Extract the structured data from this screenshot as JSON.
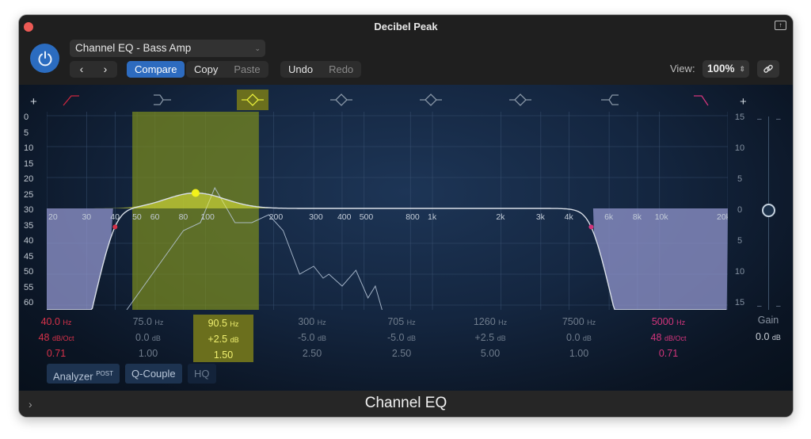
{
  "window": {
    "title": "Decibel Peak",
    "footer_title": "Channel EQ"
  },
  "toolbar": {
    "preset": "Channel EQ - Bass Amp",
    "prev_label": "‹",
    "next_label": "›",
    "compare_label": "Compare",
    "copy_label": "Copy",
    "paste_label": "Paste",
    "undo_label": "Undo",
    "redo_label": "Redo",
    "view_label": "View:",
    "view_value": "100%"
  },
  "graph": {
    "left_db_labels": [
      "0",
      "5",
      "10",
      "15",
      "20",
      "25",
      "30",
      "35",
      "40",
      "45",
      "50",
      "55",
      "60"
    ],
    "right_db_labels": [
      "15",
      "10",
      "5",
      "0",
      "5",
      "10",
      "15"
    ],
    "freq_labels": [
      "20",
      "30",
      "40",
      "50",
      "60",
      "80",
      "100",
      "200",
      "300",
      "400",
      "500",
      "800",
      "1k",
      "2k",
      "3k",
      "4k",
      "6k",
      "8k",
      "10k",
      "20k"
    ],
    "freq_values": [
      20,
      30,
      40,
      50,
      60,
      80,
      100,
      200,
      300,
      400,
      500,
      800,
      1000,
      2000,
      3000,
      4000,
      6000,
      8000,
      10000,
      20000
    ],
    "accent_color": "#e8ee3a",
    "active_band_index": 2
  },
  "bands": [
    {
      "name": "Low Cut",
      "type": "lowcut",
      "freq": "40.0",
      "freq_unit": "Hz",
      "gain": "48",
      "gain_unit": "dB/Oct",
      "q": "0.71",
      "color": "red",
      "enabled": true
    },
    {
      "name": "Low Shelf",
      "type": "lowshelf",
      "freq": "75.0",
      "freq_unit": "Hz",
      "gain": "0.0",
      "gain_unit": "dB",
      "q": "1.00",
      "color": "dim",
      "enabled": false
    },
    {
      "name": "Bell 1",
      "type": "bell",
      "freq": "90.5",
      "freq_unit": "Hz",
      "gain": "+2.5",
      "gain_unit": "dB",
      "q": "1.50",
      "color": "active",
      "enabled": true
    },
    {
      "name": "Bell 2",
      "type": "bell",
      "freq": "300",
      "freq_unit": "Hz",
      "gain": "-5.0",
      "gain_unit": "dB",
      "q": "2.50",
      "color": "dim",
      "enabled": false
    },
    {
      "name": "Bell 3",
      "type": "bell",
      "freq": "705",
      "freq_unit": "Hz",
      "gain": "-5.0",
      "gain_unit": "dB",
      "q": "2.50",
      "color": "dim",
      "enabled": false
    },
    {
      "name": "Bell 4",
      "type": "bell",
      "freq": "1260",
      "freq_unit": "Hz",
      "gain": "+2.5",
      "gain_unit": "dB",
      "q": "5.00",
      "color": "dim",
      "enabled": false
    },
    {
      "name": "High Shelf",
      "type": "highshelf",
      "freq": "7500",
      "freq_unit": "Hz",
      "gain": "0.0",
      "gain_unit": "dB",
      "q": "1.00",
      "color": "dim",
      "enabled": false
    },
    {
      "name": "High Cut",
      "type": "highcut",
      "freq": "5000",
      "freq_unit": "Hz",
      "gain": "48",
      "gain_unit": "dB/Oct",
      "q": "0.71",
      "color": "pink",
      "enabled": true
    }
  ],
  "master_gain": {
    "label": "Gain",
    "value": "0.0",
    "unit": "dB"
  },
  "options": {
    "analyzer_label": "Analyzer",
    "analyzer_mode": "POST",
    "qcouple_label": "Q-Couple",
    "hq_label": "HQ"
  }
}
